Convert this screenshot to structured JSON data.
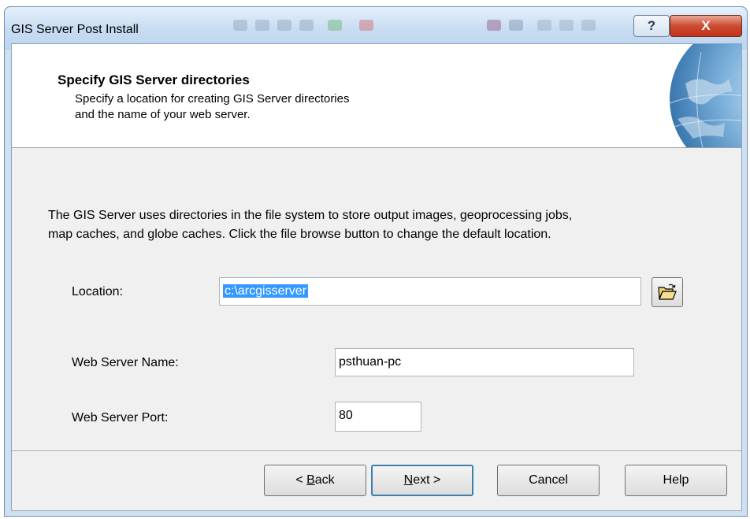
{
  "window": {
    "title": "GIS Server Post Install",
    "help_glyph": "?",
    "close_glyph": "X"
  },
  "header": {
    "title": "Specify GIS Server directories",
    "desc_line1": "Specify a location for creating GIS Server directories",
    "desc_line2": "and the name of your web server."
  },
  "intro": {
    "line1": "The GIS Server uses directories in the file system to store output images, geoprocessing jobs,",
    "line2": "map caches, and globe caches.  Click the file browse button to change the default location."
  },
  "form": {
    "location_label": "Location:",
    "location_value": "c:\\arcgisserver",
    "web_server_name_label": "Web Server Name:",
    "web_server_name_value": "psthuan-pc",
    "web_server_port_label": "Web Server Port:",
    "web_server_port_value": "80"
  },
  "buttons": {
    "back_prefix": "< ",
    "back_mnemonic": "B",
    "back_rest": "ack",
    "next_mnemonic": "N",
    "next_rest": "ext >",
    "cancel": "Cancel",
    "help": "Help"
  },
  "colors": {
    "selection": "#3399ff",
    "close_button": "#c0331a",
    "window_frame": "#cfe0f2"
  },
  "icons": {
    "browse": "open-folder-icon",
    "header_art": "globe-icon"
  }
}
